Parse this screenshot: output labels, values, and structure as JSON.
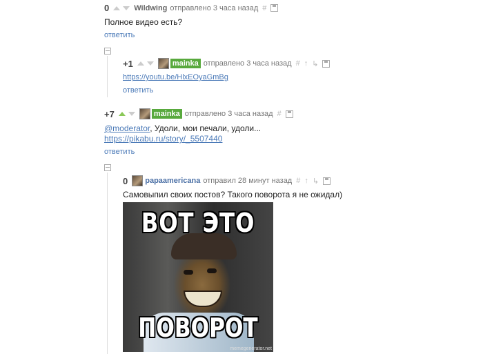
{
  "comments": [
    {
      "rating": "0",
      "user": "Wildwing",
      "time": "отправлено 3 часа назад",
      "text": "Полное видео есть?",
      "reply": "ответить"
    },
    {
      "rating": "+1",
      "user": "mainka",
      "time": "отправлено 3 часа назад",
      "link": "https://youtu.be/HlxEOyaGmBg",
      "reply": "ответить"
    },
    {
      "rating": "+7",
      "user": "mainka",
      "time": "отправлено 3 часа назад",
      "mention": "@moderator",
      "text": ", Удоли, мои печали, удоли...",
      "link": "https://pikabu.ru/story/_5507440",
      "reply": "ответить"
    },
    {
      "rating": "0",
      "user": "papaamericana",
      "time": "отправил 28 минут назад",
      "text": "Самовыпил своих постов? Такого поворота я не ожидал)",
      "meme": {
        "top_text": "ВОТ ЭТО",
        "bottom_text": "ПОВОРОТ",
        "watermark": "memegenerator.net"
      }
    }
  ],
  "icons": {
    "hash": "#",
    "up_parent": "↑",
    "branch": "↳"
  },
  "colors": {
    "link": "#4b7ab8",
    "badge": "#58a93d",
    "upvote_green": "#8ac858"
  }
}
